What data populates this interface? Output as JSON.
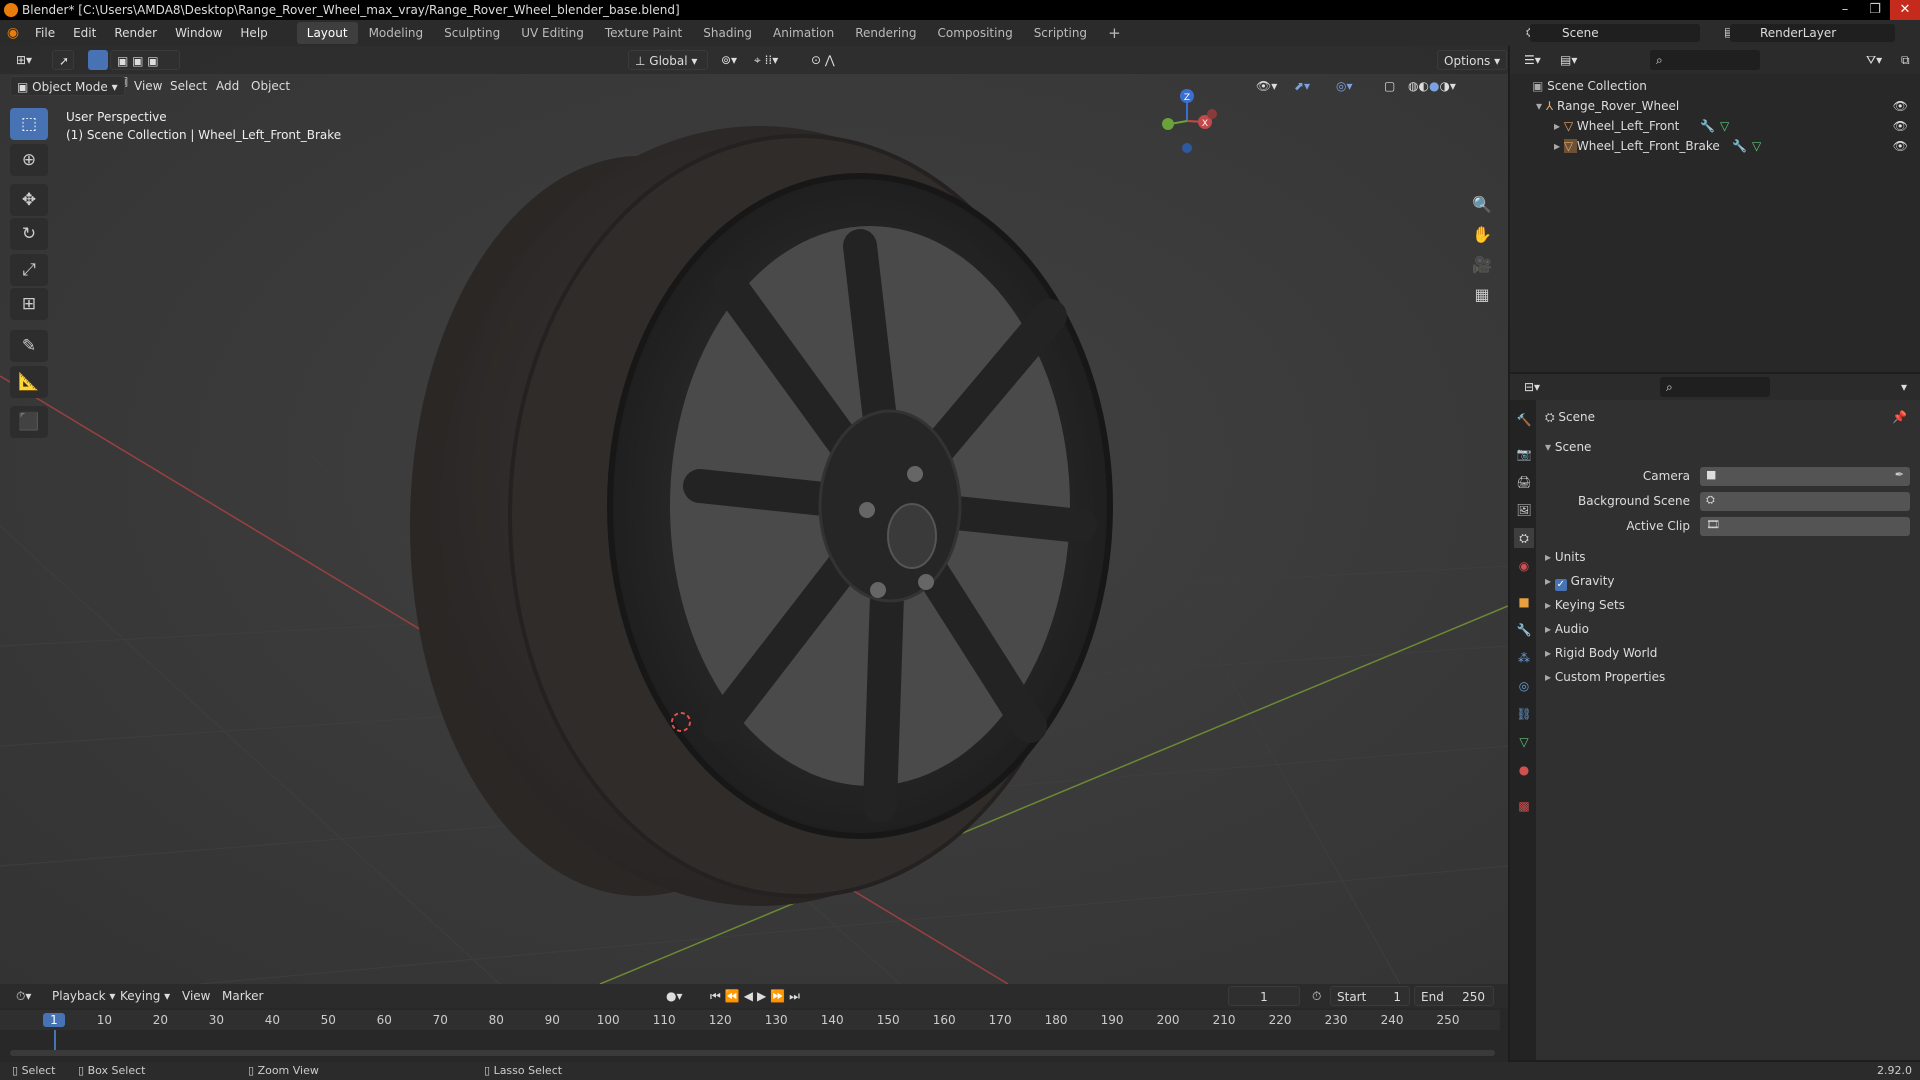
{
  "window": {
    "title": "Blender* [C:\\Users\\AMDA8\\Desktop\\Range_Rover_Wheel_max_vray/Range_Rover_Wheel_blender_base.blend]",
    "controls": [
      "–",
      "❐",
      "✕"
    ]
  },
  "menubar": {
    "items": [
      "File",
      "Edit",
      "Render",
      "Window",
      "Help"
    ],
    "workspaces": [
      "Layout",
      "Modeling",
      "Sculpting",
      "UV Editing",
      "Texture Paint",
      "Shading",
      "Animation",
      "Rendering",
      "Compositing",
      "Scripting"
    ],
    "active_workspace": "Layout",
    "add_tab": "+",
    "scene": "Scene",
    "view_layer": "RenderLayer"
  },
  "viewport": {
    "header": {
      "mode": "Object Mode",
      "menus": [
        "View",
        "Select",
        "Add",
        "Object"
      ],
      "transform_orientation": "Global",
      "options": "Options"
    },
    "overlay_text": {
      "line1": "User Perspective",
      "line2": "(1) Scene Collection | Wheel_Left_Front_Brake"
    },
    "tools": [
      "select-box",
      "cursor",
      "move",
      "rotate",
      "scale",
      "transform",
      "annotate",
      "measure",
      "add-cube"
    ],
    "gizmo": {
      "z": "Z",
      "x": "X"
    },
    "colors": {
      "x_axis": "#b84848",
      "y_axis": "#7aa33a",
      "active_tool": "#4772b3",
      "tire": "#2e2b29",
      "rim": "#242424"
    }
  },
  "outliner": {
    "root": "Scene Collection",
    "items": [
      {
        "name": "Range_Rover_Wheel",
        "depth": 1
      },
      {
        "name": "Wheel_Left_Front",
        "depth": 2
      },
      {
        "name": "Wheel_Left_Front_Brake",
        "depth": 2
      }
    ]
  },
  "properties": {
    "context": "Scene",
    "section": "Scene",
    "fields": [
      {
        "label": "Camera",
        "value": ""
      },
      {
        "label": "Background Scene",
        "value": ""
      },
      {
        "label": "Active Clip",
        "value": ""
      }
    ],
    "panels": [
      "Units",
      "Gravity",
      "Keying Sets",
      "Audio",
      "Rigid Body World",
      "Custom Properties"
    ],
    "gravity_checked": true
  },
  "timeline": {
    "menus": [
      "Playback",
      "Keying",
      "View",
      "Marker"
    ],
    "current_frame": "1",
    "start_label": "Start",
    "start": "1",
    "end_label": "End",
    "end": "250",
    "ticks": [
      "1",
      "10",
      "20",
      "30",
      "40",
      "50",
      "60",
      "70",
      "80",
      "90",
      "100",
      "110",
      "120",
      "130",
      "140",
      "150",
      "160",
      "170",
      "180",
      "190",
      "200",
      "210",
      "220",
      "230",
      "240",
      "250"
    ]
  },
  "statusbar": {
    "items": [
      "Select",
      "Box Select",
      "Zoom View",
      "Lasso Select"
    ],
    "version": "2.92.0"
  }
}
